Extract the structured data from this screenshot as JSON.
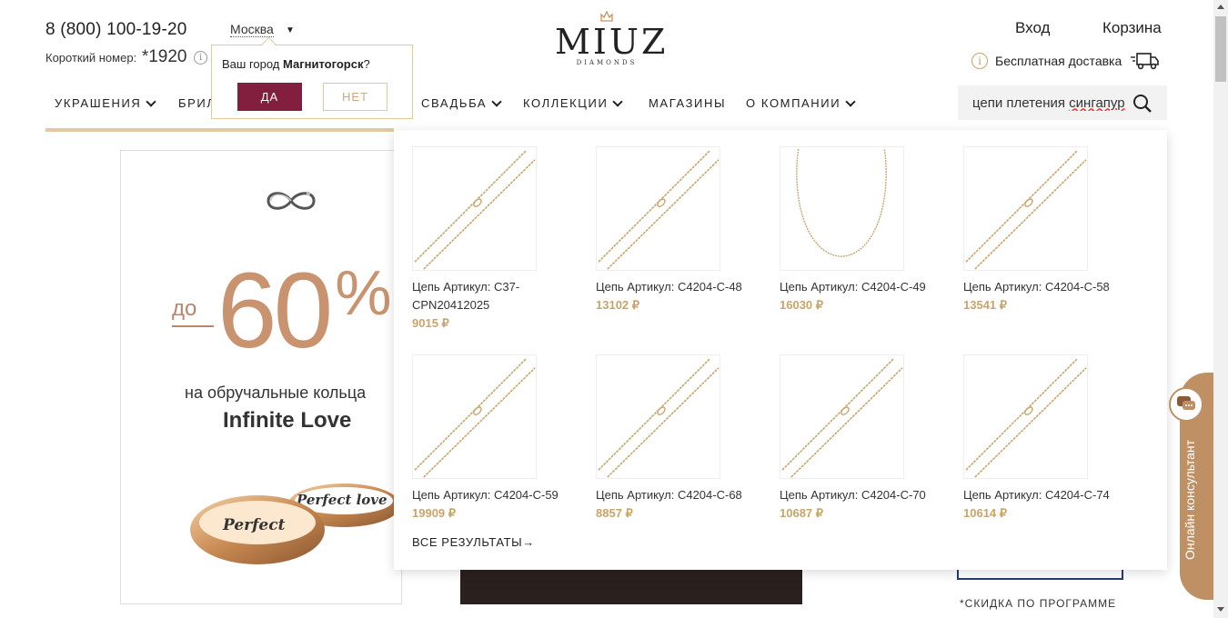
{
  "header": {
    "phone": "8 (800) 100-19-20",
    "short_label": "Короткий номер:",
    "short_number": "*1920",
    "info_glyph": "i",
    "city": "Москва",
    "logo": {
      "word": "MIUZ",
      "sub": "DIAMONDS"
    },
    "login": "Вход",
    "cart": "Корзина",
    "delivery": "Бесплатная доставка"
  },
  "city_popup": {
    "question_prefix": "Ваш город",
    "city": "Магнитогорск",
    "question_suffix": "?",
    "yes": "ДА",
    "no": "НЕТ"
  },
  "nav": {
    "items": [
      {
        "label": "УКРАШЕНИЯ",
        "has_dropdown": true
      },
      {
        "label": "БРИЛ",
        "has_dropdown": false
      },
      {
        "label": "СВАДЬБА",
        "has_dropdown": true
      },
      {
        "label": "КОЛЛЕКЦИИ",
        "has_dropdown": true
      },
      {
        "label": "МАГАЗИНЫ",
        "has_dropdown": false
      },
      {
        "label": "О КОМПАНИИ",
        "has_dropdown": true
      }
    ]
  },
  "search": {
    "value_prefix": "цепи плетения ",
    "value_error_word": "сингапур"
  },
  "banner": {
    "prefix": "до",
    "discount": "60",
    "percent": "%",
    "text": "на обручальные кольца",
    "collection": "Infinite Love",
    "ring_engraving_1": "Perfect",
    "ring_engraving_2": "Perfect love"
  },
  "results": {
    "items": [
      {
        "title": "Цепь Артикул: С37-CPN20412025",
        "price": "9015 ₽",
        "shape": "diagonal"
      },
      {
        "title": "Цепь Артикул: С4204-С-48",
        "price": "13102 ₽",
        "shape": "diagonal"
      },
      {
        "title": "Цепь Артикул: С4204-С-49",
        "price": "16030 ₽",
        "shape": "loop"
      },
      {
        "title": "Цепь Артикул: С4204-С-58",
        "price": "13541 ₽",
        "shape": "diagonal"
      },
      {
        "title": "Цепь Артикул: С4204-С-59",
        "price": "19909 ₽",
        "shape": "diagonal"
      },
      {
        "title": "Цепь Артикул: С4204-С-68",
        "price": "8857 ₽",
        "shape": "diagonal"
      },
      {
        "title": "Цепь Артикул: С4204-С-70",
        "price": "10687 ₽",
        "shape": "diagonal"
      },
      {
        "title": "Цепь Артикул: С4204-С-74",
        "price": "10614 ₽",
        "shape": "diagonal"
      }
    ],
    "all_results": "ВСЕ РЕЗУЛЬТАТЫ→"
  },
  "side": {
    "discount_note": "*СКИДКА ПО ПРОГРАММЕ"
  },
  "consultant": {
    "label": "Онлайн консультант"
  },
  "colors": {
    "brand_burgundy": "#821e3e",
    "gold": "#c9a46b",
    "accent_beige": "#e2c9a0",
    "consultant_tab": "#c09065"
  }
}
